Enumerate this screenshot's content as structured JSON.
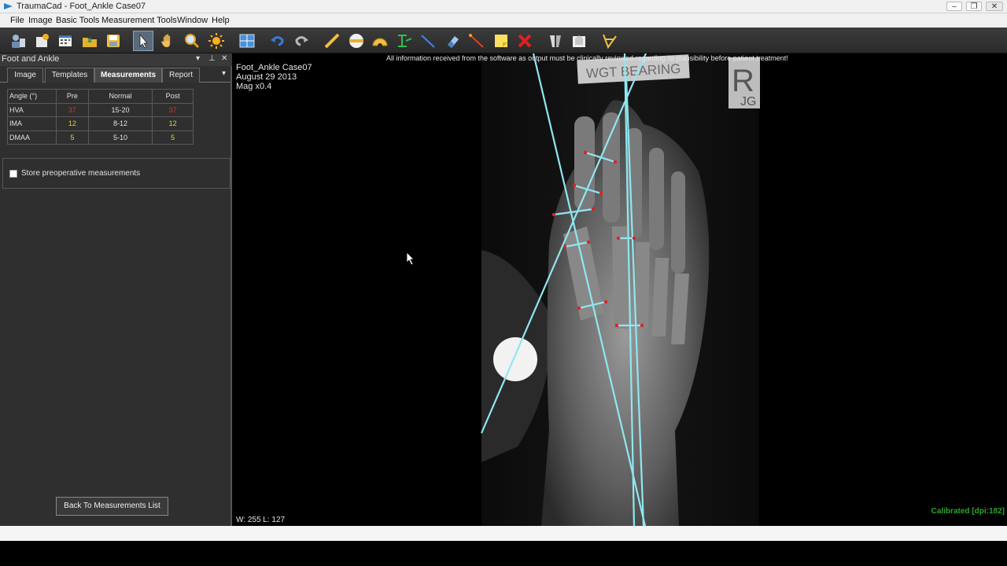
{
  "window": {
    "title": "TraumaCad - Foot_Ankle Case07"
  },
  "menu": [
    "File",
    "Image",
    "Basic Tools",
    "Measurement Tools",
    "Window",
    "Help"
  ],
  "toolbar_icons": [
    "open-patient-icon",
    "new-case-icon",
    "image-list-icon",
    "open-folder-icon",
    "save-icon",
    "select-pointer-icon",
    "pan-hand-icon",
    "zoom-magnifier-icon",
    "brightness-contrast-icon",
    "layout-grid-icon",
    "undo-icon",
    "redo-icon",
    "line-ruler-icon",
    "circle-tool-icon",
    "angle-protractor-icon",
    "parallel-lines-icon",
    "straight-line-icon",
    "eraser-icon",
    "measure-line-icon",
    "note-icon",
    "delete-icon",
    "template-tool-icon",
    "implant-tool-icon",
    "foot-angle-tool-icon"
  ],
  "panel": {
    "title": "Foot and Ankle",
    "tabs": [
      "Image",
      "Templates",
      "Measurements",
      "Report"
    ],
    "active_tab": "Measurements",
    "table": {
      "headers": [
        "Angle (°)",
        "Pre",
        "Normal",
        "Post"
      ],
      "rows": [
        {
          "angle": "HVA",
          "pre": "37",
          "normal": "15-20",
          "post": "37",
          "status": "red"
        },
        {
          "angle": "IMA",
          "pre": "12",
          "normal": "8-12",
          "post": "12",
          "status": "yellow"
        },
        {
          "angle": "DMAA",
          "pre": "5",
          "normal": "5-10",
          "post": "5",
          "status": "yellow"
        }
      ]
    },
    "store_label": "Store preoperative measurements",
    "back_button": "Back To Measurements List"
  },
  "viewer": {
    "disclaimer": "All information received from the software as output must be clinically reviewed regarding its plausibility before patient treatment!",
    "case_name": "Foot_Ankle Case07",
    "date": "August 29 2013",
    "mag": "Mag x0.4",
    "wl": "W: 255 L: 127",
    "calibration": "Calibrated [dpi:182]",
    "marker_text": "WGT BEARING",
    "side_marker": "R",
    "side_marker_sub": "JG"
  },
  "colors": {
    "measure_line": "#8fe7f0",
    "point": "#e02020",
    "red_value": "#e03030",
    "yellow_value": "#d8d830",
    "calibrated": "#2ca32c"
  }
}
